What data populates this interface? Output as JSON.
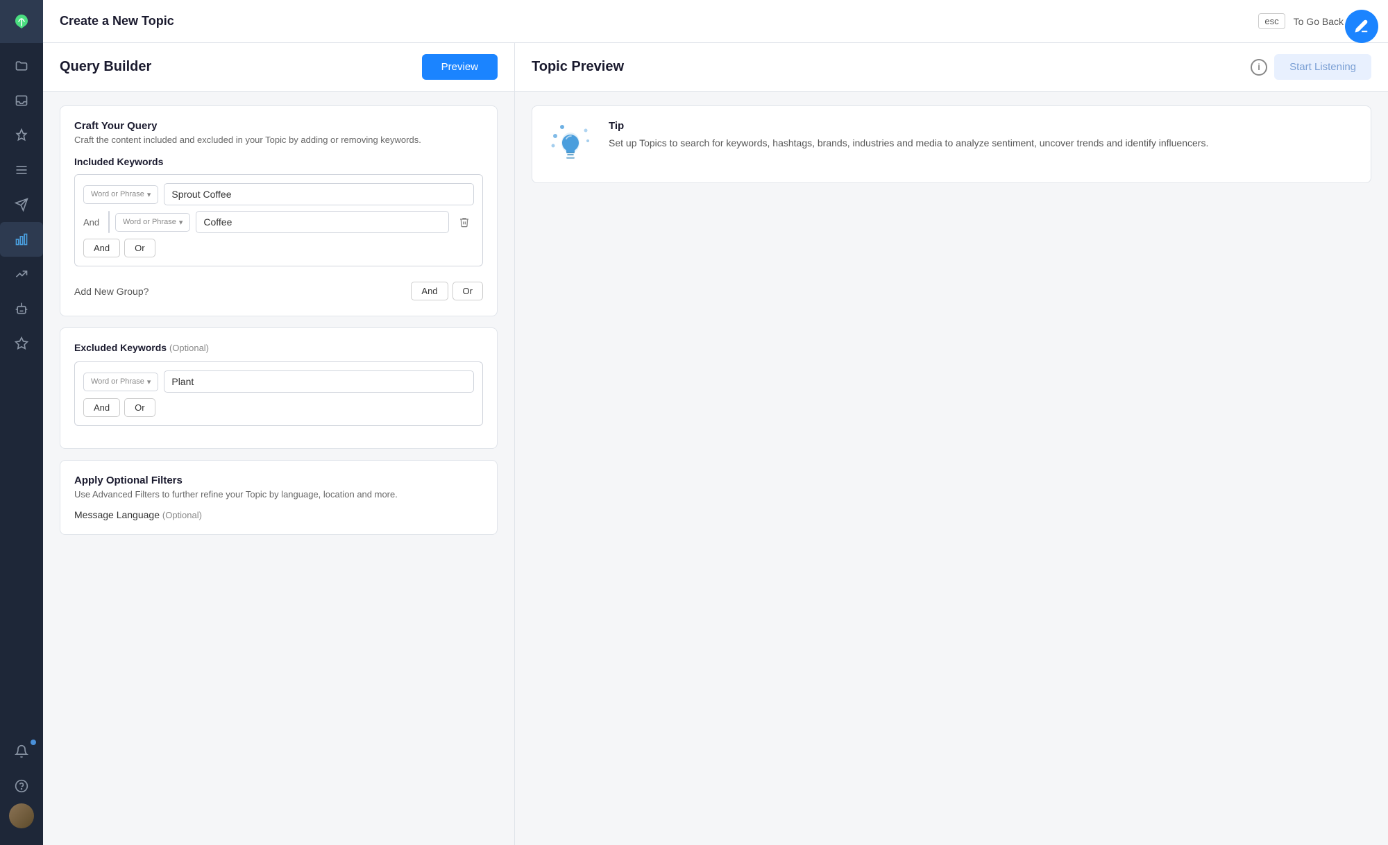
{
  "app": {
    "title": "Create a New Topic"
  },
  "header": {
    "title": "Create a New Topic",
    "esc_label": "esc",
    "to_go_back": "To Go Back",
    "close_icon": "×"
  },
  "left_panel": {
    "title": "Query Builder",
    "preview_button": "Preview"
  },
  "craft_query": {
    "title": "Craft Your Query",
    "subtitle": "Craft the content included and excluded in your Topic by adding or removing keywords.",
    "included_keywords_title": "Included Keywords",
    "excluded_keywords_title": "Excluded Keywords",
    "optional_label": "(Optional)",
    "keyword_type_label": "Word or Phrase",
    "chevron": "▾",
    "group1_keyword1_value": "Sprout Coffee",
    "group1_keyword2_value": "Coffee",
    "group1_and_label": "And",
    "group1_btn_and": "And",
    "group1_btn_or": "Or",
    "add_new_group_label": "Add New Group?",
    "add_group_btn_and": "And",
    "add_group_btn_or": "Or",
    "excluded_keyword1_value": "Plant",
    "excluded_btn_and": "And",
    "excluded_btn_or": "Or",
    "delete_icon": "🗑"
  },
  "filters": {
    "title": "Apply Optional Filters",
    "subtitle": "Use Advanced Filters to further refine your Topic by language, location and more.",
    "message_language_label": "Message Language",
    "message_language_optional": "(Optional)"
  },
  "right_panel": {
    "title": "Topic Preview",
    "info_icon": "i",
    "start_listening_btn": "Start Listening"
  },
  "tip": {
    "title": "Tip",
    "description": "Set up Topics to search for keywords, hashtags, brands, industries and media to analyze sentiment, uncover trends and identify influencers."
  },
  "sidebar": {
    "items": [
      {
        "name": "folder",
        "icon": "folder"
      },
      {
        "name": "inbox",
        "icon": "inbox"
      },
      {
        "name": "pin",
        "icon": "pin"
      },
      {
        "name": "list",
        "icon": "list"
      },
      {
        "name": "send",
        "icon": "send"
      },
      {
        "name": "analytics-active",
        "icon": "bar-chart"
      },
      {
        "name": "chart",
        "icon": "chart"
      },
      {
        "name": "robot",
        "icon": "robot"
      },
      {
        "name": "star",
        "icon": "star"
      }
    ]
  },
  "colors": {
    "accent": "#1b84ff",
    "sidebar_bg": "#1e2738",
    "active_item_bg": "#2d3a50"
  }
}
